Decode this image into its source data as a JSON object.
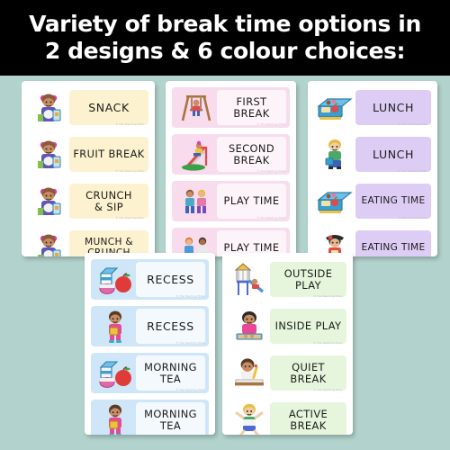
{
  "banner": {
    "line1": "Variety of break time options in",
    "line2": "2 designs & 6 colour choices:"
  },
  "colors": {
    "page_background": "#b2d3cd",
    "banner_background": "#000000",
    "banner_text": "#ffffff",
    "card_background": "#ffffff",
    "cream": "#fdf2cf",
    "pink": "#f8dced",
    "pink_chip": "#fdf4f9",
    "purple": "#ddcdf5",
    "blue": "#cfe6f8",
    "blue_chip": "#f3f9fd",
    "green": "#e6f6dc",
    "label_text": "#1b1b1b"
  },
  "cards": [
    {
      "id": "card-snack",
      "design": "design-a",
      "theme_color": "#fdf2cf",
      "rows": [
        {
          "label": "SNACK",
          "icon": "girl-with-snack-icon"
        },
        {
          "label": "FRUIT BREAK",
          "icon": "girl-with-snack-icon"
        },
        {
          "label": "CRUNCH\n& SIP",
          "icon": "girl-with-snack-icon"
        },
        {
          "label": "MUNCH &\nCRUNCH",
          "icon": "girl-with-snack-icon"
        }
      ]
    },
    {
      "id": "card-breaks",
      "design": "design-b",
      "theme_color": "#f8dced",
      "chip_color": "#fdf4f9",
      "rows": [
        {
          "label": "FIRST BREAK",
          "icon": "swing-set-icon"
        },
        {
          "label": "SECOND\nBREAK",
          "icon": "slide-icon"
        },
        {
          "label": "PLAY  TIME",
          "icon": "two-kids-playing-icon"
        },
        {
          "label": "PLAY  TIME",
          "icon": "two-kids-ball-icon"
        }
      ]
    },
    {
      "id": "card-lunch",
      "design": "design-a",
      "theme_color": "#ddcdf5",
      "rows": [
        {
          "label": "LUNCH",
          "icon": "lunchbox-icon"
        },
        {
          "label": "LUNCH",
          "icon": "boy-with-lunchbox-icon"
        },
        {
          "label": "EATING  TIME",
          "icon": "lunchbox-icon"
        },
        {
          "label": "EATING  TIME",
          "icon": "girl-with-lunch-icon"
        }
      ]
    },
    {
      "id": "card-recess",
      "design": "design-b",
      "theme_color": "#cfe6f8",
      "chip_color": "#f3f9fd",
      "rows": [
        {
          "label": "RECESS",
          "icon": "milk-and-apple-icon"
        },
        {
          "label": "RECESS",
          "icon": "girl-with-bag-icon"
        },
        {
          "label": "MORNING\nTEA",
          "icon": "milk-and-apple-icon"
        },
        {
          "label": "MORNING\nTEA",
          "icon": "girl-with-bag-icon"
        }
      ]
    },
    {
      "id": "card-play",
      "design": "design-a",
      "theme_color": "#e6f6dc",
      "rows": [
        {
          "label": "OUTSIDE\nPLAY",
          "icon": "playground-slide-icon"
        },
        {
          "label": "INSIDE PLAY",
          "icon": "girl-sandpit-icon"
        },
        {
          "label": "QUIET BREAK",
          "icon": "boy-reading-icon"
        },
        {
          "label": "ACTIVE\nBREAK",
          "icon": "boy-jumping-icon"
        }
      ]
    }
  ],
  "watermark": "© The Teaching Tribe"
}
